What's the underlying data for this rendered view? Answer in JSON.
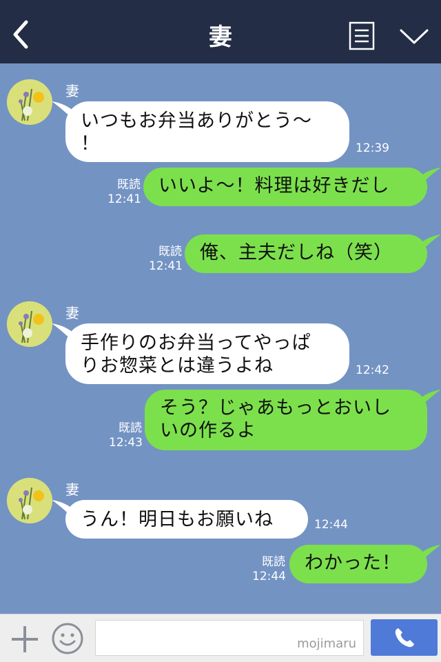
{
  "header": {
    "title": "妻",
    "back_icon": "chevron-left-icon",
    "menu_icon": "note-icon",
    "expand_icon": "chevron-down-icon"
  },
  "colors": {
    "header_bg": "#232d45",
    "chat_bg": "#7393c3",
    "incoming_bubble": "#ffffff",
    "outgoing_bubble": "#7ce04c",
    "call_button": "#4f7ad8"
  },
  "messages": [
    {
      "from": "them",
      "sender": "妻",
      "lines": [
        "いつもお弁当ありがとう〜",
        "！"
      ],
      "time": "12:39"
    },
    {
      "from": "me",
      "lines": [
        "いいよ〜！料理は好きだし"
      ],
      "read": "既読",
      "time": "12:41"
    },
    {
      "from": "me",
      "lines": [
        "俺、主夫だしね（笑）"
      ],
      "read": "既読",
      "time": "12:41"
    },
    {
      "from": "them",
      "sender": "妻",
      "lines": [
        "手作りのお弁当ってやっぱ",
        "りお惣菜とは違うよね"
      ],
      "time": "12:42"
    },
    {
      "from": "me",
      "lines": [
        "そう？じゃあもっとおいし",
        "いの作るよ"
      ],
      "read": "既読",
      "time": "12:43"
    },
    {
      "from": "them",
      "sender": "妻",
      "lines": [
        "うん！明日もお願いね"
      ],
      "time": "12:44"
    },
    {
      "from": "me",
      "lines": [
        "わかった！"
      ],
      "read": "既読",
      "time": "12:44"
    }
  ],
  "footer": {
    "input_value": "",
    "watermark": "mojimaru",
    "plus_icon": "plus-icon",
    "emoji_icon": "smiley-icon",
    "call_icon": "phone-icon"
  }
}
